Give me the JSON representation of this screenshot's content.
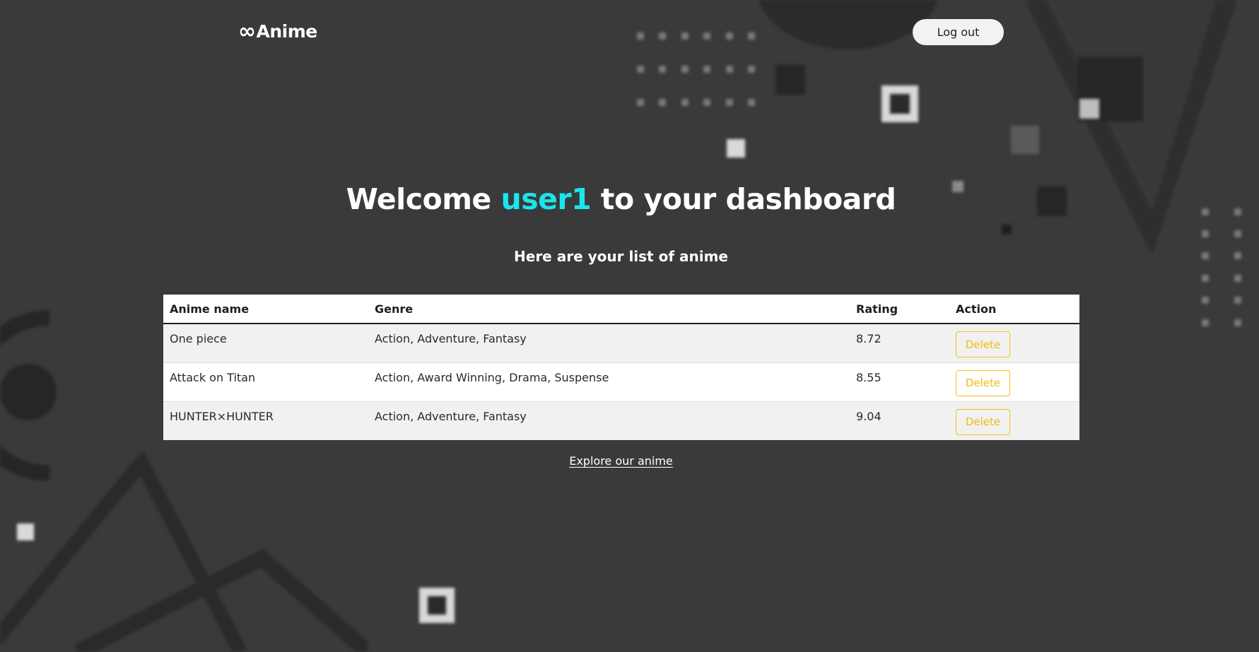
{
  "header": {
    "logo_symbol": "∞",
    "logo_text": "Anime",
    "logout_label": "Log out"
  },
  "welcome": {
    "prefix": "Welcome ",
    "username": "user1",
    "suffix": " to your dashboard"
  },
  "subtitle": "Here are your list of anime",
  "table": {
    "columns": [
      "Anime name",
      "Genre",
      "Rating",
      "Action"
    ],
    "rows": [
      {
        "name": "One piece",
        "genre": "Action, Adventure, Fantasy",
        "rating": "8.72",
        "action": "Delete"
      },
      {
        "name": "Attack on Titan",
        "genre": "Action, Award Winning, Drama, Suspense",
        "rating": "8.55",
        "action": "Delete"
      },
      {
        "name": "HUNTER×HUNTER",
        "genre": "Action, Adventure, Fantasy",
        "rating": "9.04",
        "action": "Delete"
      }
    ]
  },
  "explore_link": "Explore our anime",
  "colors": {
    "background": "#3a3a3a",
    "accent_username": "#19e6ee",
    "delete_button": "#f0bc12"
  }
}
